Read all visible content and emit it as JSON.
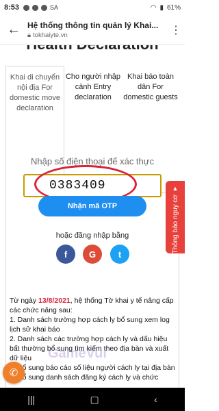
{
  "status_bar": {
    "time": "8:53",
    "carrier": "SA",
    "battery": "61%"
  },
  "app_bar": {
    "title": "Hệ thống thông tin quản lý Khai...",
    "url": "tokhaiyte.vn"
  },
  "page": {
    "heading": "Health Declaration",
    "tabs": [
      {
        "label": "Khai di chuyển nội địa For domestic move declaration",
        "active": true
      },
      {
        "label": "Cho người nhập cảnh Entry declaration",
        "active": false
      },
      {
        "label": "Khai báo toàn dân For domestic guests",
        "active": false
      }
    ],
    "phone_prompt": "Nhập số điện thoại để xác thực",
    "phone_value": "0383409",
    "otp_button": "Nhận mã OTP",
    "alt_login_text": "hoặc đăng nhập bằng",
    "social": {
      "facebook": "f",
      "google": "G",
      "twitter": "t"
    },
    "notice": {
      "prefix": "Từ ngày ",
      "date": "13/8/2021",
      "rest": ", hệ thống Tờ khai y tế nâng cấp các chức năng sau:",
      "items": [
        "1. Danh sách trường hợp cách ly bổ sung xem log lịch sử khai báo",
        "2. Danh sách các trường hợp cách ly và dấu hiệu bất thường bổ sung tìm kiếm theo địa bàn và xuất dữ liệu",
        "3. Bổ sung báo cáo số liệu người cách ly tại địa bàn",
        "4. Bổ sung danh sách đăng ký cách ly và chức"
      ]
    },
    "side_tab": "Thông báo nguy cơ",
    "watermark": "GameVui"
  }
}
